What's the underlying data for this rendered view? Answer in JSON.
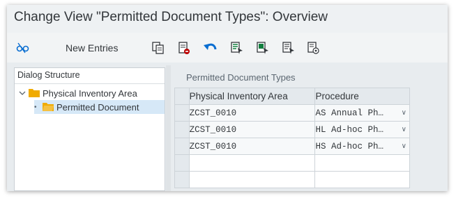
{
  "window": {
    "title": "Change View \"Permitted Document Types\": Overview"
  },
  "toolbar": {
    "new_entries_label": "New Entries",
    "icons": [
      "display-change-icon",
      "copy-icon",
      "delete-icon",
      "undo-icon",
      "select-all-icon",
      "select-block-icon",
      "deselect-all-icon",
      "config-icon"
    ]
  },
  "dialog_structure": {
    "header": "Dialog Structure",
    "items": [
      {
        "label": "Physical Inventory Area",
        "expanded": true,
        "level": 0
      },
      {
        "label": "Permitted Document",
        "selected": true,
        "level": 1
      }
    ]
  },
  "table": {
    "title": "Permitted Document Types",
    "columns": [
      "Physical Inventory Area",
      "Procedure"
    ],
    "rows": [
      {
        "area": "ZCST_0010",
        "procedure": "AS Annual Ph…"
      },
      {
        "area": "ZCST_0010",
        "procedure": "HL Ad-hoc Ph…"
      },
      {
        "area": "ZCST_0010",
        "procedure": "HS Ad-hoc Ph…"
      }
    ]
  },
  "colors": {
    "accent_blue": "#0a6ed1",
    "folder": "#f0ab00",
    "delete_red": "#bb0000",
    "select_green": "#107e3e"
  }
}
